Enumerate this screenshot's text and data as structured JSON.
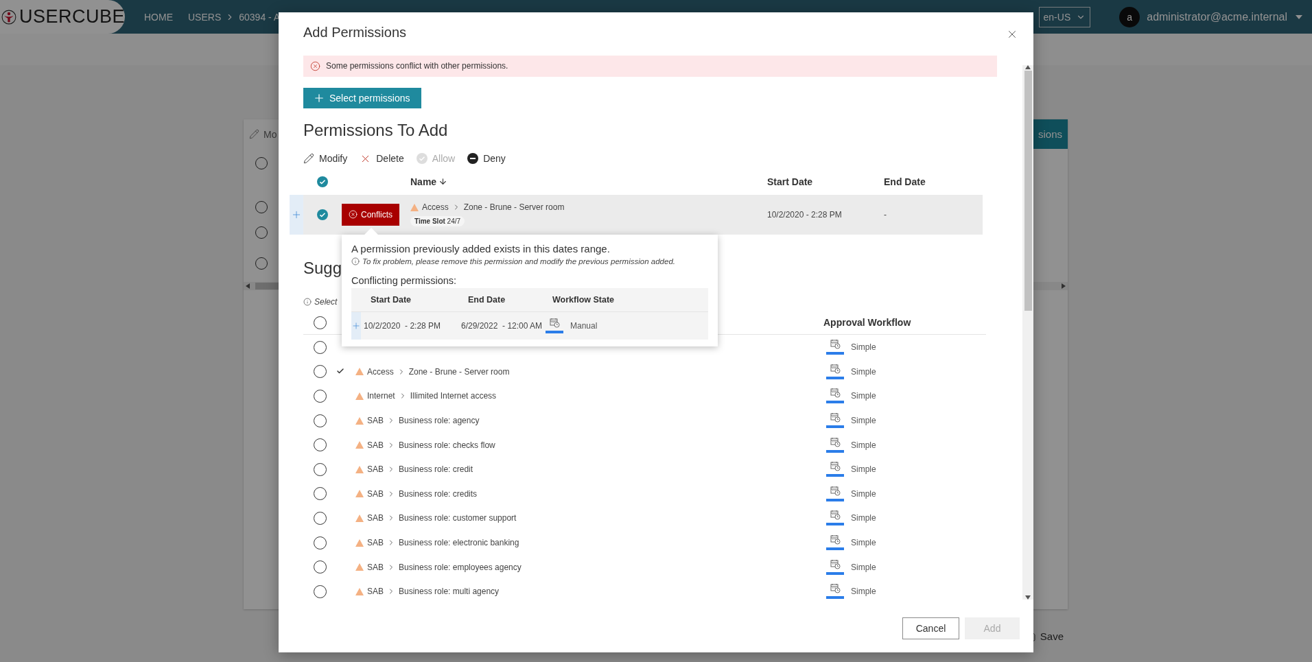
{
  "header": {
    "logo": "USERCUBE",
    "nav": [
      {
        "label": "HOME"
      }
    ],
    "breadcrumb": [
      "USERS",
      "60394 - A"
    ],
    "language": "en-US",
    "avatar": "a",
    "user": "administrator@acme.internal"
  },
  "page": {
    "toolbar_item": "Mo",
    "action_button": "sions",
    "radios": [
      {
        "selected": false
      },
      {
        "selected": false
      },
      {
        "selected": false
      },
      {
        "selected": false
      }
    ],
    "save_button": "Save"
  },
  "dialog": {
    "title": "Add Permissions",
    "error": "Some permissions conflict with other permissions.",
    "select_button": "Select permissions",
    "heading": "Permissions To Add",
    "toolbar": [
      {
        "label": "Modify",
        "kind": "modify",
        "disabled": false
      },
      {
        "label": "Delete",
        "kind": "delete",
        "disabled": false
      },
      {
        "label": "Allow",
        "kind": "allow",
        "disabled": true
      },
      {
        "label": "Deny",
        "kind": "deny",
        "disabled": false
      }
    ],
    "table": {
      "all_checked": true,
      "columns": [
        "Name",
        "Start Date",
        "End Date"
      ],
      "rows": [
        {
          "checked": true,
          "conflict_button": "Conflicts",
          "category": "Access",
          "name": "Zone - Brune - Server room",
          "tag": "**Time Slot** 24/7",
          "start": "10/2/2020 - 2:28 PM",
          "end": "-"
        }
      ]
    },
    "popover": {
      "title": "A permission previously added exists in this dates range.",
      "note": "To fix problem, please remove this permission and modify the previous permission added.",
      "subtitle": "Conflicting permissions:",
      "columns": [
        "Start Date",
        "End Date",
        "Workflow State"
      ],
      "rows": [
        {
          "start": "10/2/2020  - 2:28 PM",
          "end": "6/29/2022  - 12:00 AM",
          "workflow": "Manual"
        }
      ]
    },
    "suggested": {
      "heading": "Sugg",
      "info": "Select",
      "all_selected": false,
      "columns": [
        "Approval Workflow"
      ],
      "rows": [
        {
          "selected": false,
          "added": false,
          "workflow": "Simple"
        },
        {
          "selected": false,
          "added": true,
          "category": "Access",
          "name": "Zone - Brune - Server room",
          "workflow": "Simple"
        },
        {
          "selected": false,
          "added": false,
          "category": "Internet",
          "name": "Illimited Internet access",
          "workflow": "Simple"
        },
        {
          "selected": false,
          "added": false,
          "category": "SAB",
          "name": "Business role: agency",
          "workflow": "Simple"
        },
        {
          "selected": false,
          "added": false,
          "category": "SAB",
          "name": "Business role: checks flow",
          "workflow": "Simple"
        },
        {
          "selected": false,
          "added": false,
          "category": "SAB",
          "name": "Business role: credit",
          "workflow": "Simple"
        },
        {
          "selected": false,
          "added": false,
          "category": "SAB",
          "name": "Business role: credits",
          "workflow": "Simple"
        },
        {
          "selected": false,
          "added": false,
          "category": "SAB",
          "name": "Business role: customer support",
          "workflow": "Simple"
        },
        {
          "selected": false,
          "added": false,
          "category": "SAB",
          "name": "Business role: electronic banking",
          "workflow": "Simple"
        },
        {
          "selected": false,
          "added": false,
          "category": "SAB",
          "name": "Business role: employees agency",
          "workflow": "Simple"
        },
        {
          "selected": false,
          "added": false,
          "category": "SAB",
          "name": "Business role: multi agency",
          "workflow": "Simple"
        }
      ]
    },
    "buttons": [
      {
        "label": "Cancel",
        "disabled": false
      },
      {
        "label": "Add",
        "disabled": true
      }
    ]
  }
}
